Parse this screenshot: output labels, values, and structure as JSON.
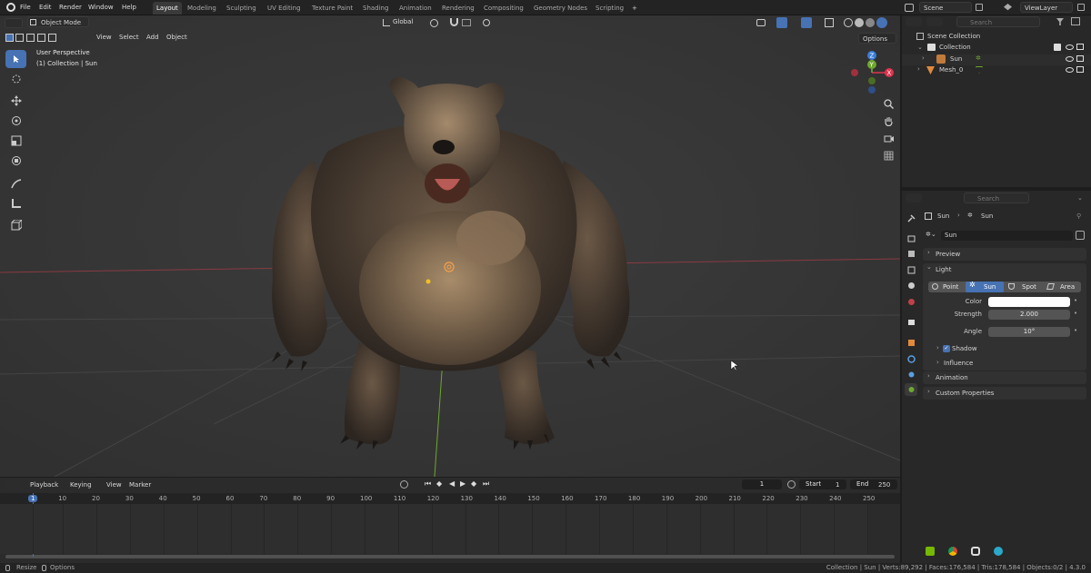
{
  "menu": {
    "file": "File",
    "edit": "Edit",
    "render": "Render",
    "window": "Window",
    "help": "Help"
  },
  "workspaces": [
    "Layout",
    "Modeling",
    "Sculpting",
    "UV Editing",
    "Texture Paint",
    "Shading",
    "Animation",
    "Rendering",
    "Compositing",
    "Geometry Nodes",
    "Scripting"
  ],
  "workspace_add": "+",
  "scene": {
    "name": "Scene",
    "view_layer": "ViewLayer"
  },
  "viewport": {
    "mode": "Object Mode",
    "menus": {
      "view": "View",
      "select": "Select",
      "add": "Add",
      "object": "Object"
    },
    "transform_orientation": "Global",
    "options": "Options",
    "info_line1": "User Perspective",
    "info_line2": "(1) Collection | Sun",
    "gizmo": {
      "z": "Z",
      "y": "Y",
      "x": "X"
    }
  },
  "outliner": {
    "search_placeholder": "Search",
    "scene_collection": "Scene Collection",
    "collection": "Collection",
    "items": [
      {
        "name": "Sun"
      },
      {
        "name": "Mesh_0"
      }
    ]
  },
  "properties": {
    "search_placeholder": "Search",
    "breadcrumb_object": "Sun",
    "breadcrumb_data": "Sun",
    "data_name": "Sun",
    "panels": {
      "preview": "Preview",
      "light": "Light",
      "shadow": "Shadow",
      "influence": "Influence",
      "animation": "Animation",
      "custom_properties": "Custom Properties"
    },
    "light_types": [
      "Point",
      "Sun",
      "Spot",
      "Area"
    ],
    "active_light_type": "Sun",
    "color_label": "Color",
    "color_value": "#ffffff",
    "strength_label": "Strength",
    "strength_value": "2.000",
    "angle_label": "Angle",
    "angle_value": "10°",
    "shadow_enabled": true
  },
  "timeline": {
    "menus": {
      "playback": "Playback",
      "keying": "Keying",
      "view": "View",
      "marker": "Marker"
    },
    "current_frame": "1",
    "start_label": "Start",
    "start_value": "1",
    "end_label": "End",
    "end_value": "250",
    "frame_marks": [
      "1",
      "10",
      "20",
      "30",
      "40",
      "50",
      "60",
      "70",
      "80",
      "90",
      "100",
      "110",
      "120",
      "130",
      "140",
      "150",
      "160",
      "170",
      "180",
      "190",
      "200",
      "210",
      "220",
      "230",
      "240",
      "250"
    ]
  },
  "statusbar": {
    "left1": "Resize",
    "left2": "Options",
    "right": "Collection | Sun | Verts:89,292 | Faces:176,584 | Tris:178,584 | Objects:0/2 | 4.3.0"
  },
  "colors": {
    "accent": "#4772b3",
    "x_axis": "#e0344f",
    "y_axis": "#6ea82f",
    "z_axis": "#3a7ddb"
  }
}
